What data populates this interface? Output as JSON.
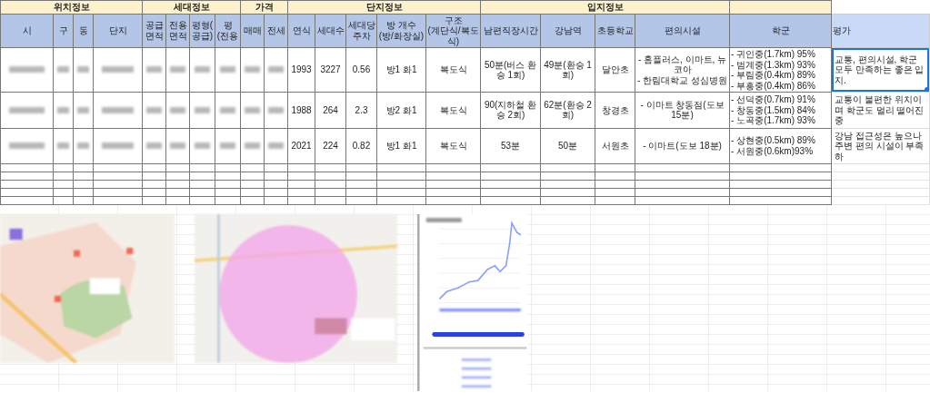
{
  "table": {
    "column_groups": [
      {
        "label": "위치정보",
        "redacted": true,
        "columns": [
          "시",
          "구",
          "동",
          "단지"
        ]
      },
      {
        "label": "세대정보",
        "redacted": true,
        "columns": [
          "공급\n면적",
          "전용\n면적",
          "평형(\n공급)",
          "평\n(전용"
        ]
      },
      {
        "label": "가격",
        "redacted": true,
        "columns": [
          "매매",
          "전세"
        ]
      },
      {
        "label": "단지정보",
        "columns": [
          "연식",
          "세대수",
          "세대당\n주차",
          "방 개수\n(방/화장실)",
          "구조\n(계단식/복도식)"
        ]
      },
      {
        "label": "입지정보",
        "columns": [
          "남편직장시간",
          "강남역",
          "초등학교",
          "편의시설"
        ]
      },
      {
        "columns": [
          "학군"
        ]
      }
    ],
    "evaluation_header": "평가",
    "rows": [
      {
        "cells": [
          "1993",
          "3227",
          "0.56",
          "방1 화1",
          "복도식",
          "50분(버스 환승 1회)",
          "49분(환승 1회)",
          "달안초",
          "- 홈플러스, 이마트, 뉴코아\n- 한림대학교 성심병원",
          "- 귀인중(1.7km) 95%\n- 범계중(1.3km) 93%\n- 부림중(0.4km) 89%\n- 부흥중(0.4km) 86%"
        ],
        "evaluation": {
          "text": "교통, 편의시설, 학군 모두 만족하는 좋은 입지.",
          "selected": true
        }
      },
      {
        "cells": [
          "1988",
          "264",
          "2.3",
          "방2 화1",
          "복도식",
          "90(지하철 환승 2회)",
          "62분(환승 2회)",
          "창경초",
          "- 이마트 창동점(도보 15분)",
          "- 선덕중(0.7km) 91%\n- 창동중(1.5km) 84%\n- 노곡중(1.7km) 93%"
        ],
        "evaluation": {
          "text": "교통이 불편한 위치이며 학군도 멀리 떨어진 중",
          "selected": false
        }
      },
      {
        "cells": [
          "2021",
          "224",
          "0.82",
          "방1 화1",
          "복도식",
          "53분",
          "50분",
          "서원초",
          "- 이마트(도보 18분)",
          "- 상현중(0.5km) 89%\n- 서원중(0.6km)93%"
        ],
        "evaluation": {
          "text": "강남 접근성은 높으나 주변 편의 시설이 부족하",
          "selected": false
        }
      }
    ]
  },
  "pictures": [
    {
      "kind": "map"
    },
    {
      "kind": "map-radius"
    },
    {
      "kind": "chart-screenshot"
    }
  ]
}
